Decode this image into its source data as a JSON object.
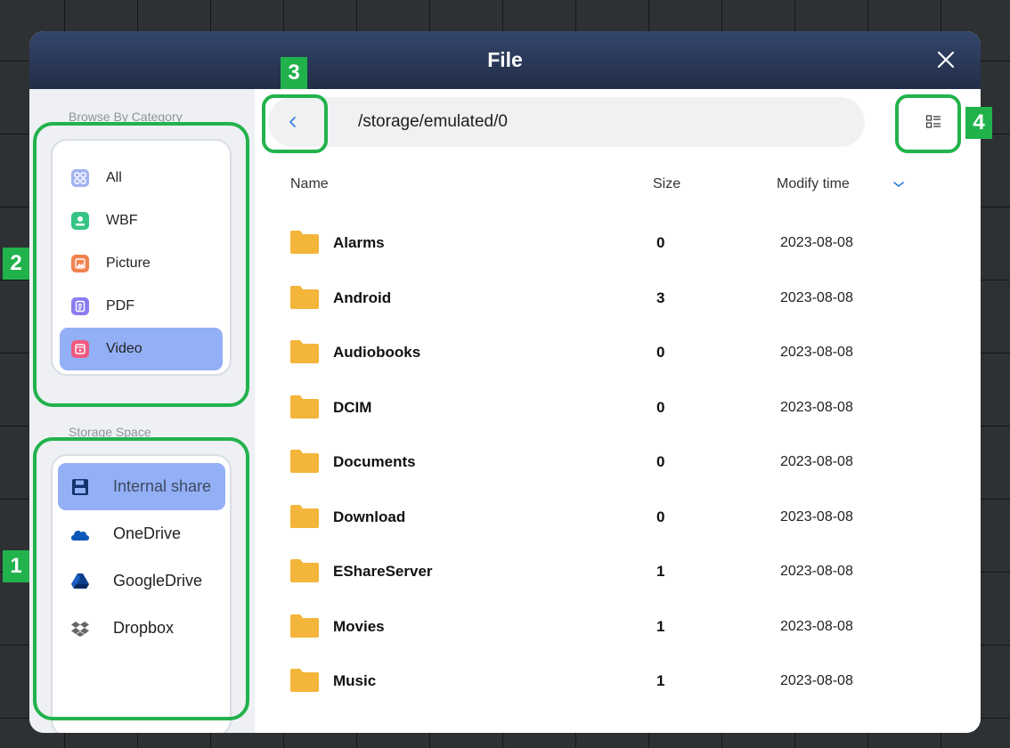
{
  "dialog": {
    "title": "File"
  },
  "sidebar": {
    "category_heading": "Browse By Category",
    "categories": [
      {
        "label": "All",
        "icon": "grid-icon",
        "color": "#a3b3f0"
      },
      {
        "label": "WBF",
        "icon": "whiteboard-file-icon",
        "color": "#36c486"
      },
      {
        "label": "Picture",
        "icon": "picture-icon",
        "color": "#f1834f"
      },
      {
        "label": "PDF",
        "icon": "document-icon",
        "color": "#8a7cf0"
      },
      {
        "label": "Video",
        "icon": "video-icon",
        "color": "#ef5a7e",
        "active": true
      }
    ],
    "storage_heading": "Storage Space",
    "storage": [
      {
        "label": "Internal share",
        "icon": "floppy-disk-icon",
        "active": true
      },
      {
        "label": "OneDrive",
        "icon": "onedrive-cloud-icon"
      },
      {
        "label": "GoogleDrive",
        "icon": "google-drive-icon"
      },
      {
        "label": "Dropbox",
        "icon": "dropbox-icon"
      }
    ]
  },
  "main": {
    "path": "/storage/emulated/0",
    "columns": {
      "name": "Name",
      "size": "Size",
      "modify": "Modify time"
    },
    "files": [
      {
        "name": "Alarms",
        "size": "0",
        "date": "2023-08-08"
      },
      {
        "name": "Android",
        "size": "3",
        "date": "2023-08-08"
      },
      {
        "name": "Audiobooks",
        "size": "0",
        "date": "2023-08-08"
      },
      {
        "name": "DCIM",
        "size": "0",
        "date": "2023-08-08"
      },
      {
        "name": "Documents",
        "size": "0",
        "date": "2023-08-08"
      },
      {
        "name": "Download",
        "size": "0",
        "date": "2023-08-08"
      },
      {
        "name": "EShareServer",
        "size": "1",
        "date": "2023-08-08"
      },
      {
        "name": "Movies",
        "size": "1",
        "date": "2023-08-08"
      },
      {
        "name": "Music",
        "size": "1",
        "date": "2023-08-08"
      }
    ]
  },
  "annotations": {
    "badge1": "1",
    "badge2": "2",
    "badge3": "3",
    "badge4": "4"
  },
  "colors": {
    "highlight": "#22b24c",
    "active_item": "#93b0f7",
    "folder": "#f3b53a",
    "titlebar": "#2b3858"
  }
}
